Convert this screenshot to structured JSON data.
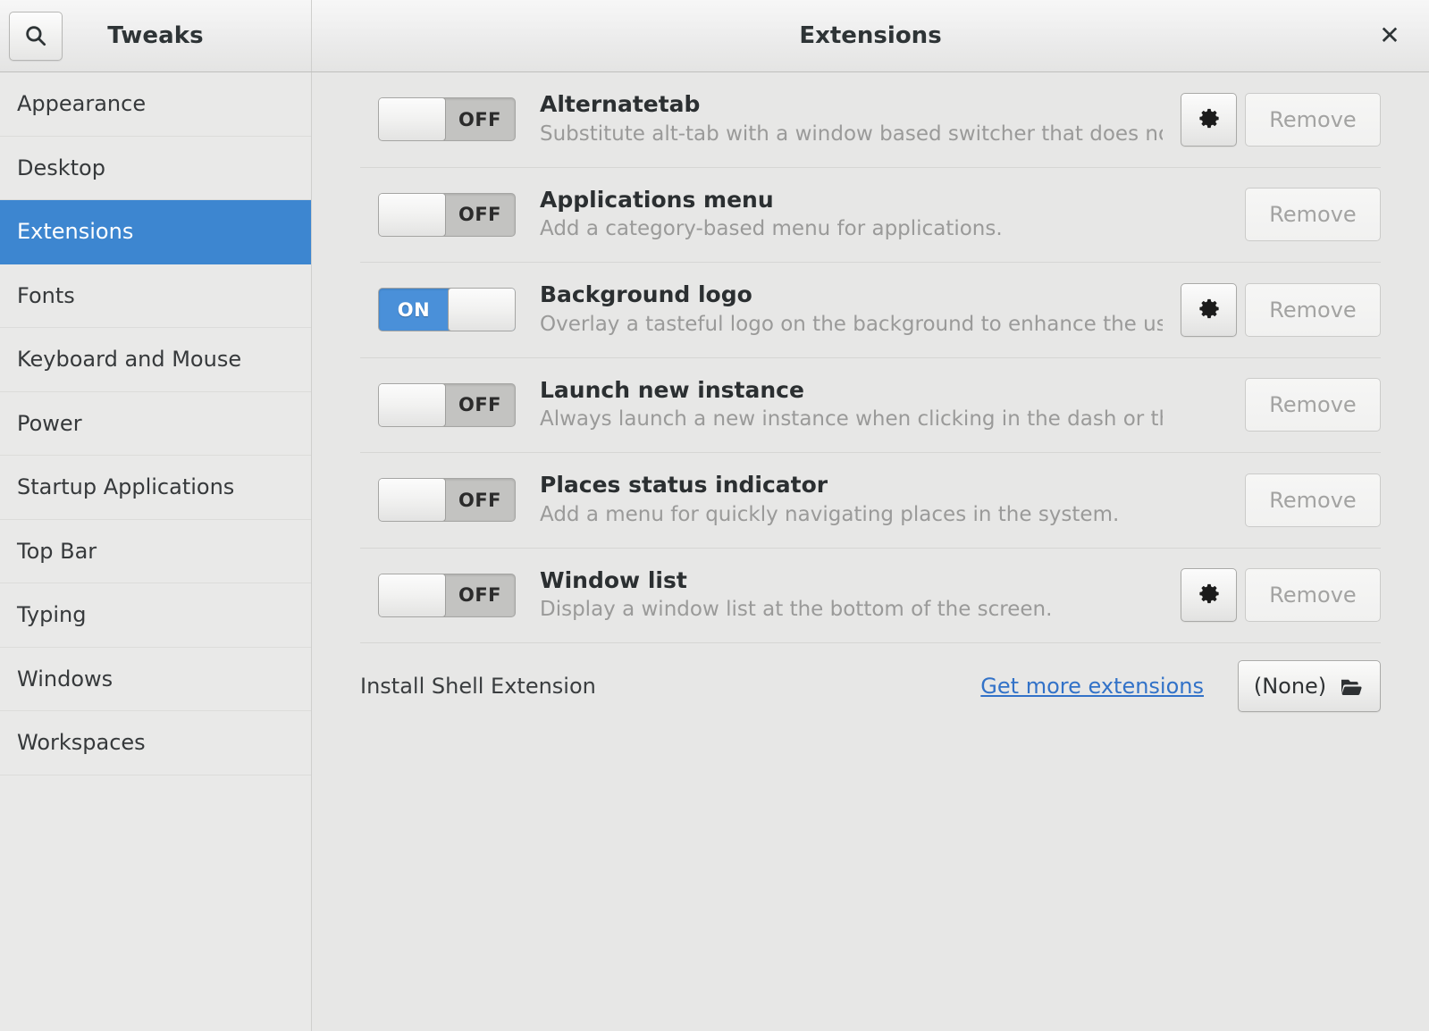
{
  "titlebar": {
    "app_title": "Tweaks",
    "page_title": "Extensions",
    "search_icon": "search-icon",
    "close_label": "✕"
  },
  "sidebar": {
    "items": [
      {
        "label": "Appearance",
        "selected": false
      },
      {
        "label": "Desktop",
        "selected": false
      },
      {
        "label": "Extensions",
        "selected": true
      },
      {
        "label": "Fonts",
        "selected": false
      },
      {
        "label": "Keyboard and Mouse",
        "selected": false
      },
      {
        "label": "Power",
        "selected": false
      },
      {
        "label": "Startup Applications",
        "selected": false
      },
      {
        "label": "Top Bar",
        "selected": false
      },
      {
        "label": "Typing",
        "selected": false
      },
      {
        "label": "Windows",
        "selected": false
      },
      {
        "label": "Workspaces",
        "selected": false
      }
    ]
  },
  "extensions": [
    {
      "name": "Alternatetab",
      "description": "Substitute alt-tab with a window based switcher that does not group…",
      "state": "OFF",
      "enabled": false,
      "has_settings": true,
      "remove_label": "Remove"
    },
    {
      "name": "Applications menu",
      "description": "Add a category-based menu for applications.",
      "state": "OFF",
      "enabled": false,
      "has_settings": false,
      "remove_label": "Remove"
    },
    {
      "name": "Background logo",
      "description": "Overlay a tasteful logo on the background to enhance the user experie…",
      "state": "ON",
      "enabled": true,
      "has_settings": true,
      "remove_label": "Remove"
    },
    {
      "name": "Launch new instance",
      "description": "Always launch a new instance when clicking in the dash or the application vie…",
      "state": "OFF",
      "enabled": false,
      "has_settings": false,
      "remove_label": "Remove"
    },
    {
      "name": "Places status indicator",
      "description": "Add a menu for quickly navigating places in the system.",
      "state": "OFF",
      "enabled": false,
      "has_settings": false,
      "remove_label": "Remove"
    },
    {
      "name": "Window list",
      "description": "Display a window list at the bottom of the screen.",
      "state": "OFF",
      "enabled": false,
      "has_settings": true,
      "remove_label": "Remove"
    }
  ],
  "install_bar": {
    "label": "Install Shell Extension",
    "link_label": "Get more extensions",
    "file_button_label": "(None)",
    "file_button_icon": "file-open-icon"
  },
  "colors": {
    "accent": "#3d86d0",
    "toggle_on": "#4a90d9",
    "toggle_off_track": "#c3c3c1",
    "link": "#3272c8",
    "sidebar_bg": "#e9e9e8",
    "content_bg": "#e7e7e6",
    "disabled_text": "#a3a3a2"
  }
}
